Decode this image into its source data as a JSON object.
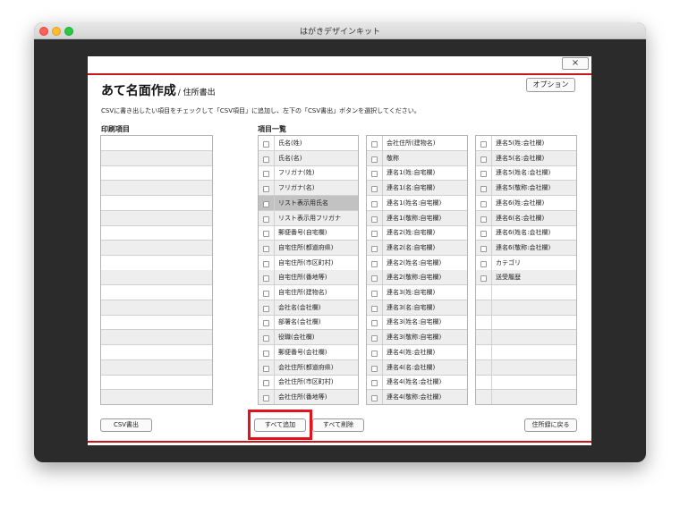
{
  "window": {
    "title": "はがきデザインキット"
  },
  "dialog": {
    "close_label": "×",
    "title": "あて名面作成",
    "subtitle": "/ 住所書出",
    "option_button": "オプション",
    "instruction": "CSVに書き出したい項目をチェックして「CSV項目」に追加し、左下の「CSV書出」ボタンを選択してください。",
    "print_items_label": "印刷項目",
    "items_list_label": "項目一覧"
  },
  "columns": [
    {
      "items": [
        "氏名(姓)",
        "氏名(名)",
        "フリガナ(姓)",
        "フリガナ(名)",
        "リスト表示用氏名",
        "リスト表示用フリガナ",
        "郵便番号(自宅欄)",
        "自宅住所(都道府県)",
        "自宅住所(市区町村)",
        "自宅住所(番地等)",
        "自宅住所(建物名)",
        "会社名(会社欄)",
        "部署名(会社欄)",
        "役職(会社欄)",
        "郵便番号(会社欄)",
        "会社住所(都道府県)",
        "会社住所(市区町村)",
        "会社住所(番地等)"
      ]
    },
    {
      "items": [
        "会社住所(建物名)",
        "敬称",
        "連名1(姓:自宅欄)",
        "連名1(名:自宅欄)",
        "連名1(姓名:自宅欄)",
        "連名1(敬称:自宅欄)",
        "連名2(姓:自宅欄)",
        "連名2(名:自宅欄)",
        "連名2(姓名:自宅欄)",
        "連名2(敬称:自宅欄)",
        "連名3(姓:自宅欄)",
        "連名3(名:自宅欄)",
        "連名3(姓名:自宅欄)",
        "連名3(敬称:自宅欄)",
        "連名4(姓:会社欄)",
        "連名4(名:会社欄)",
        "連名4(姓名:会社欄)",
        "連名4(敬称:会社欄)"
      ]
    },
    {
      "items": [
        "連名5(姓:会社欄)",
        "連名5(名:会社欄)",
        "連名5(姓名:会社欄)",
        "連名5(敬称:会社欄)",
        "連名6(姓:会社欄)",
        "連名6(名:会社欄)",
        "連名6(姓名:会社欄)",
        "連名6(敬称:会社欄)",
        "カテゴリ",
        "送受履歴"
      ]
    }
  ],
  "selected_item": "リスト表示用氏名",
  "buttons": {
    "csv_export": "CSV書出",
    "add_all": "すべて追加",
    "remove_all": "すべて削除",
    "back_to_address_book": "住所録に戻る"
  },
  "colors": {
    "accent": "#c8161d",
    "highlight": "#e0121b"
  },
  "icons": {
    "close": "close-icon",
    "checkbox": "checkbox-icon"
  }
}
